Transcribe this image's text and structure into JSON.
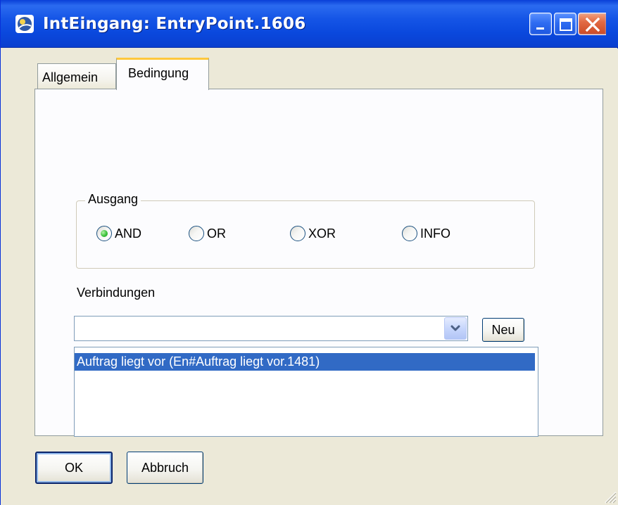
{
  "window": {
    "title": "IntEingang: EntryPoint.1606",
    "icons": {
      "app": "app-icon",
      "minimize": "minimize-icon",
      "maximize": "maximize-icon",
      "close": "close-icon"
    },
    "colors": {
      "titlebar": "#0a48dd",
      "body": "#ece9d8",
      "panel": "#fcfcfe",
      "selection": "#316ac5",
      "close_button": "#e26a44"
    }
  },
  "tabs": [
    {
      "label": "Allgemein",
      "active": false
    },
    {
      "label": "Bedingung",
      "active": true
    }
  ],
  "output_group": {
    "label": "Ausgang",
    "options": [
      {
        "label": "AND",
        "checked": true
      },
      {
        "label": "OR",
        "checked": false
      },
      {
        "label": "XOR",
        "checked": false
      },
      {
        "label": "INFO",
        "checked": false
      }
    ]
  },
  "connections": {
    "label": "Verbindungen",
    "combo_value": "",
    "new_button": "Neu",
    "items": [
      "Auftrag liegt vor (En#Auftrag liegt vor.1481)"
    ],
    "selected_index": 0,
    "dropdown_icon": "chevron-down-icon"
  },
  "footer": {
    "ok_label": "OK",
    "cancel_label": "Abbruch",
    "resize_icon": "resize-grip-icon"
  }
}
